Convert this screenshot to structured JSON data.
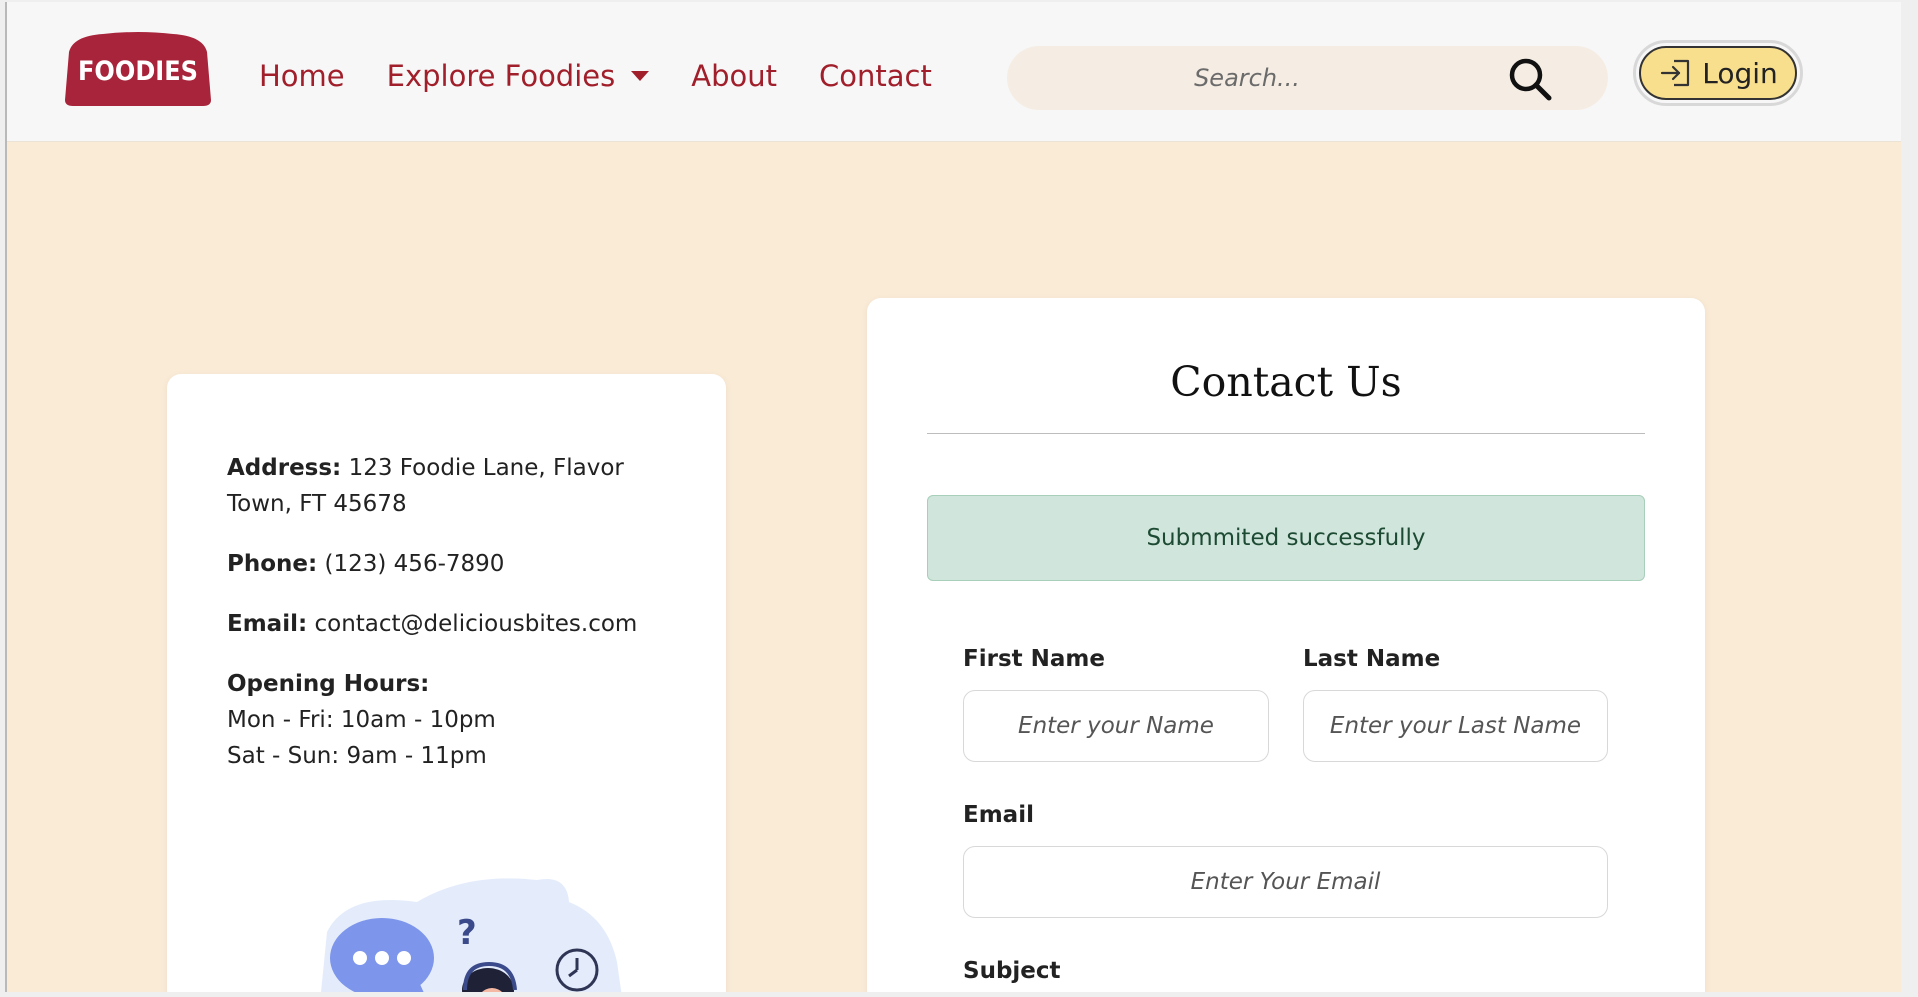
{
  "brand": {
    "logo_text": "FOODIES",
    "logo_color": "#a8243a"
  },
  "nav": {
    "home": "Home",
    "explore": "Explore Foodies",
    "about": "About",
    "contact": "Contact"
  },
  "search": {
    "placeholder": "Search...",
    "icon": "search-icon"
  },
  "login": {
    "label": "Login",
    "icon": "login-icon"
  },
  "info": {
    "address_label": "Address:",
    "address_value": "123 Foodie Lane, Flavor Town, FT 45678",
    "phone_label": "Phone:",
    "phone_value": "(123) 456-7890",
    "email_label": "Email:",
    "email_value": "contact@deliciousbites.com",
    "hours_label": "Opening Hours:",
    "hours_weekday": "Mon - Fri: 10am - 10pm",
    "hours_weekend": "Sat - Sun: 9am - 11pm"
  },
  "contact_form": {
    "title": "Contact Us",
    "success_message": "Submmited successfully",
    "first_name_label": "First Name",
    "first_name_placeholder": "Enter your Name",
    "last_name_label": "Last Name",
    "last_name_placeholder": "Enter your Last Name",
    "email_label": "Email",
    "email_placeholder": "Enter Your Email",
    "subject_label": "Subject"
  },
  "colors": {
    "accent": "#a01f2a",
    "page_background": "#faebd7",
    "success_background": "#d0e5db",
    "login_background": "#f8df8e"
  }
}
